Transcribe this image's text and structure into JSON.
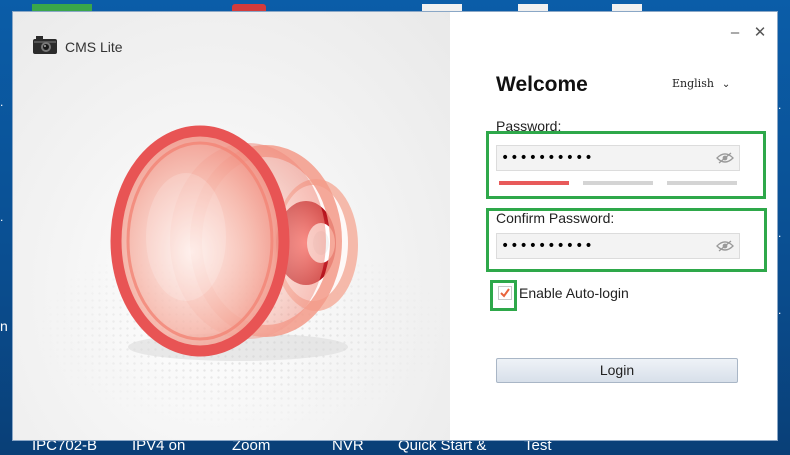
{
  "app": {
    "title": "CMS Lite"
  },
  "window_controls": {
    "minimize": "–",
    "close": "✕"
  },
  "login": {
    "welcome": "Welcome",
    "language": "English",
    "password_label": "Password:",
    "password_value": "••••••••••",
    "password_strength_levels_filled": 1,
    "password_strength_levels_total": 3,
    "confirm_label": "Confirm Password:",
    "confirm_value": "••••••••••",
    "auto_login_label": "Enable Auto-login",
    "auto_login_checked": true,
    "login_button": "Login"
  },
  "taskbar": {
    "items": [
      "IPC702-B",
      "IPV4 on",
      "Zoom",
      "NVR",
      "Quick Start &",
      "Test"
    ]
  },
  "desktop_edge_text": {
    "left_marker": "n"
  },
  "colors": {
    "highlight": "#2ea84a",
    "strength_active": "#e85a5a",
    "strength_inactive": "#d4d4d4",
    "desktop": "#0b5da8"
  },
  "icons": {
    "app_logo": "camera-icon",
    "password_eye": "eye-slash-icon",
    "confirm_eye": "eye-slash-icon",
    "lang_chevron": "chevron-down-icon"
  }
}
